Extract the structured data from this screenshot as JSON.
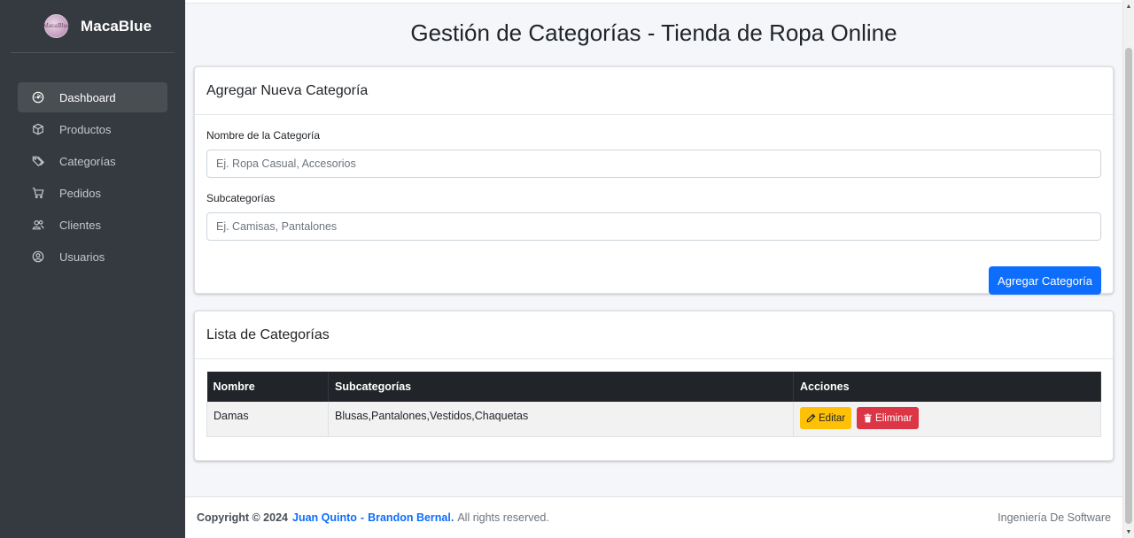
{
  "sidebar": {
    "brand_name": "MacaBlue",
    "items": [
      {
        "label": "Dashboard",
        "icon": "dashboard-icon"
      },
      {
        "label": "Productos",
        "icon": "box-icon"
      },
      {
        "label": "Categorías",
        "icon": "tags-icon"
      },
      {
        "label": "Pedidos",
        "icon": "cart-icon"
      },
      {
        "label": "Clientes",
        "icon": "people-icon"
      },
      {
        "label": "Usuarios",
        "icon": "user-circle-icon"
      }
    ],
    "active_item": "Dashboard"
  },
  "page": {
    "title": "Gestión de Categorías - Tienda de Ropa Online"
  },
  "add_card": {
    "header": "Agregar Nueva Categoría",
    "name_label": "Nombre de la Categoría",
    "name_value": "",
    "name_placeholder": "Ej. Ropa Casual, Accesorios",
    "sub_label": "Subcategorías",
    "sub_value": "",
    "sub_placeholder": "Ej. Camisas, Pantalones",
    "submit_label": "Agregar Categoría"
  },
  "list_card": {
    "header": "Lista de Categorías",
    "columns": [
      "Nombre",
      "Subcategorías",
      "Acciones"
    ],
    "rows": [
      {
        "name": "Damas",
        "subcategories": "Blusas,Pantalones,Vestidos,Chaquetas",
        "edit_label": "Editar",
        "delete_label": "Eliminar"
      }
    ]
  },
  "footer": {
    "copyright": "Copyright © 2024",
    "author1": "Juan Quinto",
    "separator": "-",
    "author2": "Brandon Bernal.",
    "rights": "All rights reserved.",
    "right_text": "Ingeniería De Software"
  },
  "colors": {
    "sidebar_bg": "#343a40",
    "primary": "#0d6efd",
    "warning": "#ffc107",
    "danger": "#dc3545",
    "table_header": "#212529"
  }
}
